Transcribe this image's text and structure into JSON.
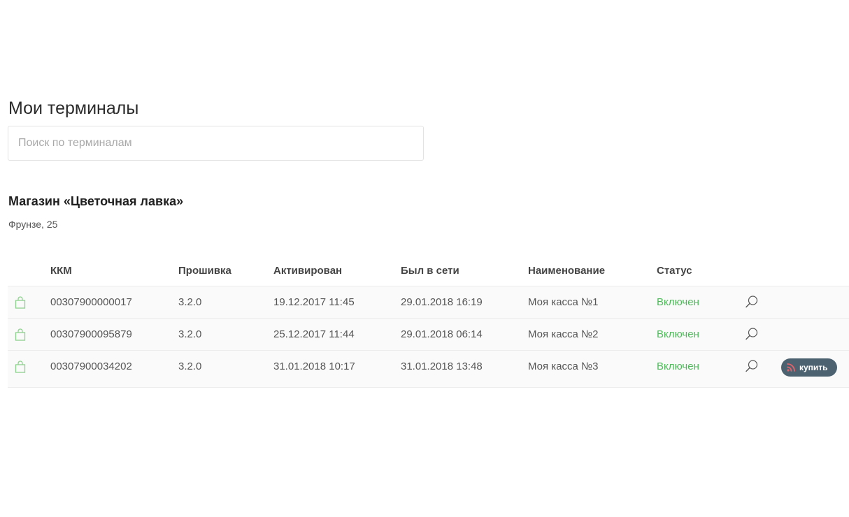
{
  "page": {
    "title": "Мои терминалы"
  },
  "search": {
    "placeholder": "Поиск по терминалам",
    "value": ""
  },
  "store": {
    "name": "Магазин «Цветочная лавка»",
    "address": "Фрунзе, 25"
  },
  "table": {
    "headers": {
      "kkm": "ККМ",
      "firmware": "Прошивка",
      "activated": "Активирован",
      "last_online": "Был в сети",
      "name": "Наименование",
      "status": "Статус"
    },
    "rows": [
      {
        "kkm": "00307900000017",
        "firmware": "3.2.0",
        "activated": "19.12.2017 11:45",
        "last_online": "29.01.2018 16:19",
        "name": "Моя касса №1",
        "status": "Включен"
      },
      {
        "kkm": "00307900095879",
        "firmware": "3.2.0",
        "activated": "25.12.2017 11:44",
        "last_online": "29.01.2018 06:14",
        "name": "Моя касса №2",
        "status": "Включен"
      },
      {
        "kkm": "00307900034202",
        "firmware": "3.2.0",
        "activated": "31.01.2018 10:17",
        "last_online": "31.01.2018 13:48",
        "name": "Моя касса №3",
        "status": "Включен",
        "buy_label": "купить"
      }
    ]
  },
  "icons": {
    "row_icon": "shopping-bag-icon",
    "action_icon": "search-icon",
    "buy_icon": "signal-icon"
  },
  "colors": {
    "status_on": "#4fb85a",
    "bag_icon": "#8fd18f",
    "buy_button_bg": "#4d6270",
    "buy_icon": "#e0626b"
  }
}
